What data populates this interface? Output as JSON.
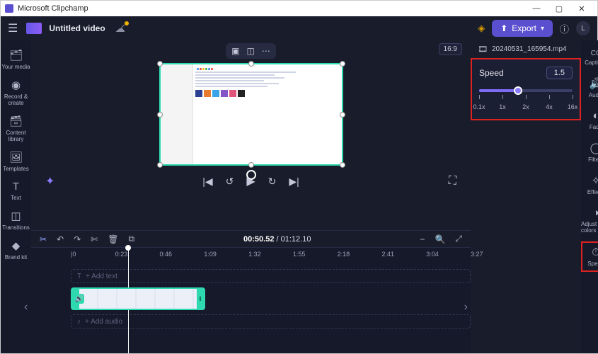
{
  "app": {
    "title": "Microsoft Clipchamp"
  },
  "project": {
    "title": "Untitled video"
  },
  "topbar": {
    "export_label": "Export",
    "help_tooltip": "Help"
  },
  "left_rail": [
    {
      "icon": "🗂",
      "label": "Your media"
    },
    {
      "icon": "◉",
      "label": "Record & create"
    },
    {
      "icon": "🗃",
      "label": "Content library"
    },
    {
      "icon": "🖼",
      "label": "Templates"
    },
    {
      "icon": "T",
      "label": "Text"
    },
    {
      "icon": "◫",
      "label": "Transitions"
    },
    {
      "icon": "◆",
      "label": "Brand kit"
    }
  ],
  "canvas": {
    "aspect_label": "16:9"
  },
  "transport": {
    "autocaptions": "✦",
    "skip_start": "|◀",
    "back": "↺",
    "play": "▶",
    "forward": "↻",
    "skip_end": "▶|",
    "fullscreen": "⛶"
  },
  "toolbar": {
    "split": "✂",
    "undo": "↶",
    "redo": "↷",
    "cut": "✄",
    "delete": "🗑",
    "duplicate": "⧉",
    "time_current": "00:50.52",
    "time_total": "01:12.10",
    "zoom_out": "−",
    "zoom_in": "🔍",
    "fit": "⤢"
  },
  "ruler": {
    "labels": [
      "|0",
      "0:23",
      "0:46",
      "1:09",
      "1:32",
      "1:55",
      "2:18",
      "2:41",
      "3:04",
      "3:27"
    ]
  },
  "tracks": {
    "text": {
      "placeholder": "+ Add text"
    },
    "audio": {
      "placeholder": "+ Add audio"
    }
  },
  "right_rail": [
    {
      "icon": "CC",
      "label": "Captions"
    },
    {
      "icon": "🔊",
      "label": "Audio"
    },
    {
      "icon": "◐",
      "label": "Fade"
    },
    {
      "icon": "◯",
      "label": "Filters"
    },
    {
      "icon": "✧",
      "label": "Effects"
    },
    {
      "icon": "◑",
      "label": "Adjust colors"
    },
    {
      "icon": "⏱",
      "label": "Speed"
    }
  ],
  "file_selected": {
    "name": "20240531_165954.mp4"
  },
  "speed": {
    "title": "Speed",
    "value": "1.5",
    "slider_percent": 42,
    "ticks": [
      {
        "pos": 0,
        "label": "0.1x"
      },
      {
        "pos": 25,
        "label": "1x"
      },
      {
        "pos": 50,
        "label": "2x"
      },
      {
        "pos": 75,
        "label": "4x"
      },
      {
        "pos": 100,
        "label": "16x"
      }
    ]
  }
}
